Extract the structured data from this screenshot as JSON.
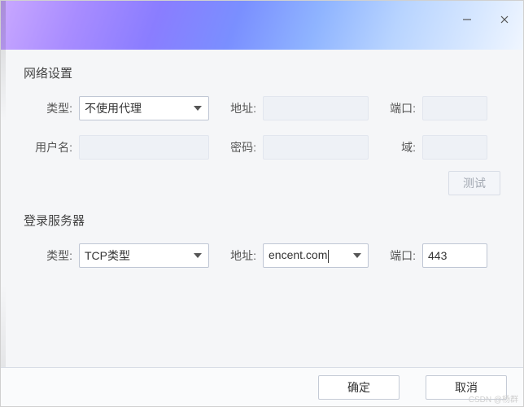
{
  "titlebar": {
    "minimize_icon": "minimize",
    "close_icon": "close"
  },
  "network": {
    "title": "网络设置",
    "type_label": "类型:",
    "type_value": "不使用代理",
    "addr_label": "地址:",
    "addr_value": "",
    "port_label": "端口:",
    "port_value": "",
    "user_label": "用户名:",
    "user_value": "",
    "pass_label": "密码:",
    "pass_value": "",
    "domain_label": "域:",
    "domain_value": "",
    "test_label": "测试"
  },
  "login": {
    "title": "登录服务器",
    "type_label": "类型:",
    "type_value": "TCP类型",
    "addr_label": "地址:",
    "addr_value": "encent.com",
    "port_label": "端口:",
    "port_value": "443"
  },
  "footer": {
    "ok_label": "确定",
    "cancel_label": "取消"
  },
  "watermark": "CSDN @杨群"
}
